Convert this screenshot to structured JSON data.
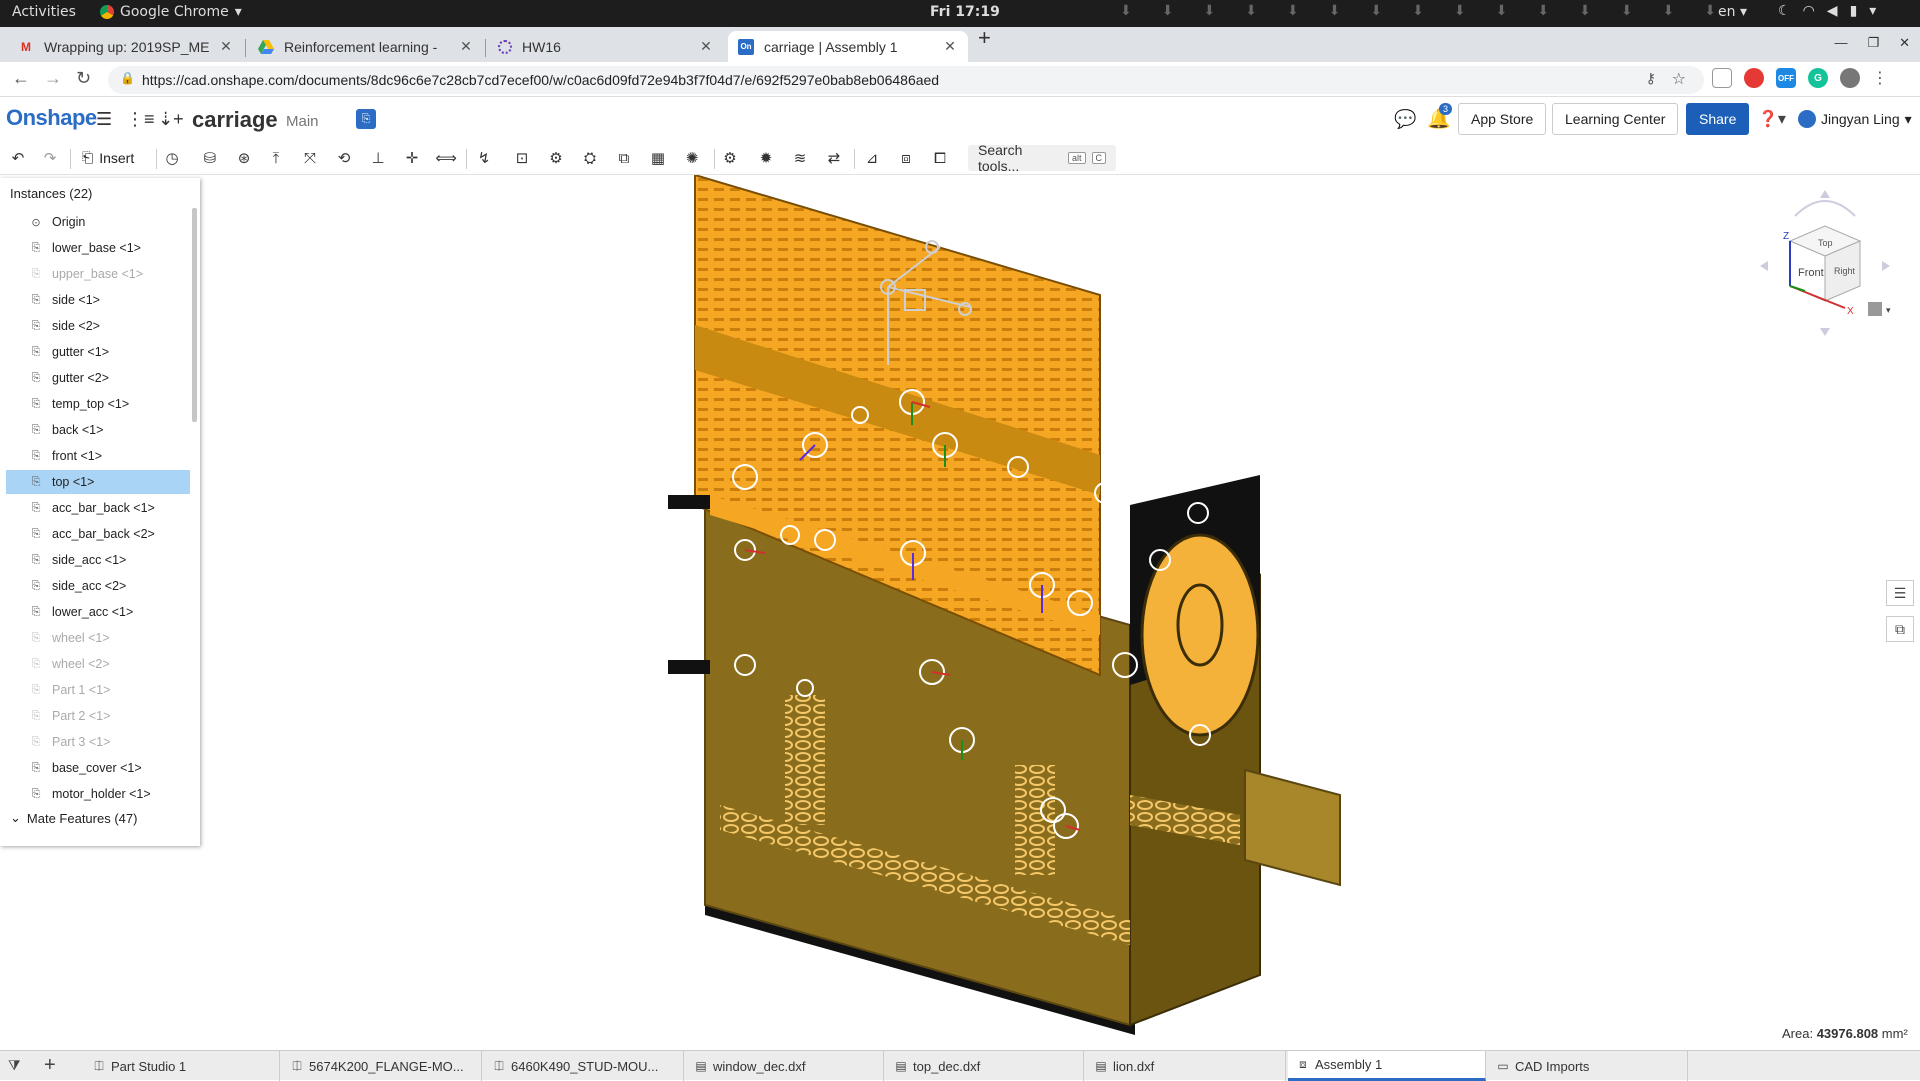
{
  "gnome": {
    "activities": "Activities",
    "app_name": "Google Chrome",
    "clock": "Fri 17:19",
    "lang": "en"
  },
  "browser": {
    "tabs": [
      {
        "title": "Wrapping up: 2019SP_ME",
        "icon": "gmail-icon"
      },
      {
        "title": "Reinforcement learning -",
        "icon": "google-drive-icon"
      },
      {
        "title": "HW16",
        "icon": "hw-icon"
      },
      {
        "title": "carriage | Assembly 1",
        "icon": "onshape-icon"
      }
    ],
    "url": "https://cad.onshape.com/documents/8dc96c6e7c28cb7cd7ecef00/w/c0ac6d09fd72e94b3f7f04d7/e/692f5297e0bab8eb06486aed",
    "ext_badges": {
      "off": "OFF"
    }
  },
  "onshape": {
    "logo": "Onshape",
    "doc_title": "carriage",
    "branch": "Main",
    "notification_count": "3",
    "app_store": "App Store",
    "learning_center": "Learning Center",
    "share": "Share",
    "user": "Jingyan Ling",
    "insert": "Insert",
    "search_tools": "Search tools...",
    "kbd_alt": "alt",
    "kbd_c": "C",
    "badge_letter": "On"
  },
  "instances": {
    "header": "Instances (22)",
    "items": [
      {
        "label": "Origin",
        "hidden": false
      },
      {
        "label": "lower_base <1>",
        "hidden": false
      },
      {
        "label": "upper_base <1>",
        "hidden": true
      },
      {
        "label": "side <1>",
        "hidden": false
      },
      {
        "label": "side <2>",
        "hidden": false
      },
      {
        "label": "gutter <1>",
        "hidden": false
      },
      {
        "label": "gutter <2>",
        "hidden": false
      },
      {
        "label": "temp_top <1>",
        "hidden": false
      },
      {
        "label": "back <1>",
        "hidden": false
      },
      {
        "label": "front <1>",
        "hidden": false
      },
      {
        "label": "top <1>",
        "hidden": false,
        "selected": true
      },
      {
        "label": "acc_bar_back <1>",
        "hidden": false
      },
      {
        "label": "acc_bar_back <2>",
        "hidden": false
      },
      {
        "label": "side_acc <1>",
        "hidden": false
      },
      {
        "label": "side_acc <2>",
        "hidden": false
      },
      {
        "label": "lower_acc <1>",
        "hidden": false
      },
      {
        "label": "wheel <1>",
        "hidden": true
      },
      {
        "label": "wheel <2>",
        "hidden": true
      },
      {
        "label": "Part 1 <1>",
        "hidden": true
      },
      {
        "label": "Part 2 <1>",
        "hidden": true
      },
      {
        "label": "Part 3 <1>",
        "hidden": true
      },
      {
        "label": "base_cover <1>",
        "hidden": false
      },
      {
        "label": "motor_holder <1>",
        "hidden": false
      }
    ],
    "mate_features": "Mate Features (47)"
  },
  "viewcube": {
    "front": "Front",
    "top": "Top",
    "right": "Right",
    "z": "Z",
    "x": "X"
  },
  "status": {
    "area_label": "Area:",
    "area_value": "43976.808",
    "area_unit": "mm²"
  },
  "bottom_tabs": [
    {
      "label": "Part Studio 1",
      "icon": "part-studio-icon"
    },
    {
      "label": "5674K200_FLANGE-MO...",
      "icon": "part-studio-icon"
    },
    {
      "label": "6460K490_STUD-MOU...",
      "icon": "part-studio-icon"
    },
    {
      "label": "window_dec.dxf",
      "icon": "drawing-icon"
    },
    {
      "label": "top_dec.dxf",
      "icon": "drawing-icon"
    },
    {
      "label": "lion.dxf",
      "icon": "drawing-icon"
    },
    {
      "label": "Assembly 1",
      "icon": "assembly-icon",
      "active": true
    },
    {
      "label": "CAD Imports",
      "icon": "folder-icon"
    }
  ],
  "colors": {
    "accent": "#2b6cc4",
    "part_orange": "#f5a623",
    "part_olive": "#8a6d1c",
    "selection": "#aad4f5"
  }
}
